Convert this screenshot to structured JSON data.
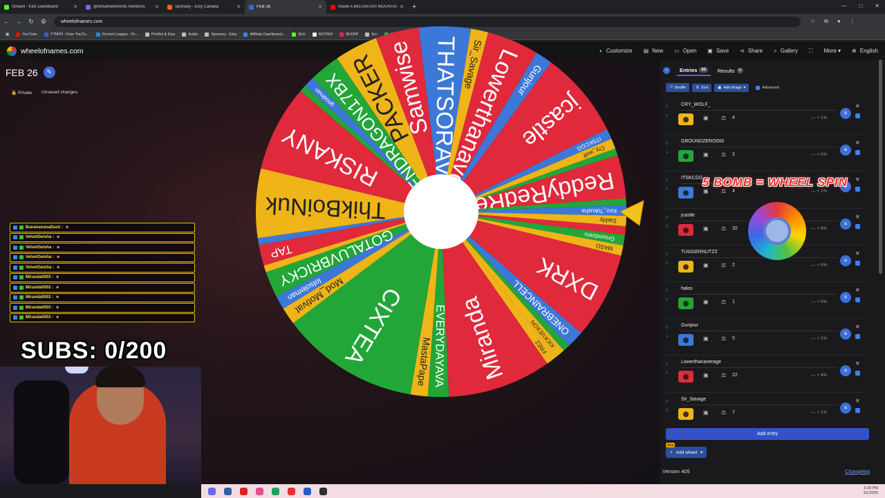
{
  "browser": {
    "tabs": [
      {
        "title": "Stream - Kick Dashboard",
        "color": "#53fc18",
        "active": false
      },
      {
        "title": "@streamelements mentions",
        "color": "#8b5cf6",
        "active": false
      },
      {
        "title": "Sponsey - Etsy Canada",
        "color": "#f1641e",
        "active": false
      },
      {
        "title": "FEB 26",
        "color": "#3369e8",
        "active": true
      },
      {
        "title": "Inside A $43,000,000 MOUNTAIN",
        "color": "#ff0000",
        "active": false
      }
    ],
    "url": "wheelofnames.com",
    "bookmarks": [
      {
        "label": "YouTube",
        "color": "#ff0000"
      },
      {
        "label": "YTMP3 - Free YouTu...",
        "color": "#3b5bdb"
      },
      {
        "label": "Rocket League - Dr...",
        "color": "#1e88e5"
      },
      {
        "label": "Printful & Etsy",
        "color": "#bbbbbb"
      },
      {
        "label": "Audio",
        "color": "#bbbbbb"
      },
      {
        "label": "Sponsey - Etsy",
        "color": "#bbbbbb"
      },
      {
        "label": "Affiliate Dashboard...",
        "color": "#3b82f6"
      },
      {
        "label": "Kick",
        "color": "#53fc18"
      },
      {
        "label": "BOTRIX",
        "color": "#eeeeee"
      },
      {
        "label": "BLERP",
        "color": "#e91e63"
      },
      {
        "label": "ttcc",
        "color": "#bbbbbb"
      },
      {
        "label": "SUH DRIVE",
        "color": "#34a853"
      }
    ]
  },
  "site": {
    "logo": "wheelofnames.com",
    "menu": [
      {
        "label": "Customize",
        "icon": "palette-icon",
        "glyph": "◐"
      },
      {
        "label": "New",
        "icon": "file-icon",
        "glyph": "▤"
      },
      {
        "label": "Open",
        "icon": "folder-icon",
        "glyph": "▭"
      },
      {
        "label": "Save",
        "icon": "save-icon",
        "glyph": "▣"
      },
      {
        "label": "Share",
        "icon": "share-icon",
        "glyph": "⋖"
      },
      {
        "label": "Gallery",
        "icon": "search-icon",
        "glyph": "⌕"
      },
      {
        "label": "",
        "icon": "fullscreen-icon",
        "glyph": "⛶"
      },
      {
        "label": "More ▾",
        "icon": "",
        "glyph": ""
      },
      {
        "label": "English",
        "icon": "globe-icon",
        "glyph": "⊕"
      }
    ]
  },
  "wheel": {
    "title": "FEB 26",
    "privacy": "Private",
    "status": "Unsaved changes",
    "colors": {
      "red": "#e0293b",
      "blue": "#3c78d8",
      "green": "#23a638",
      "yellow": "#eeb418"
    },
    "slices": [
      {
        "name": "THATSORAVEN",
        "color": "blue",
        "size": 3
      },
      {
        "name": "Sir_Savage",
        "color": "yellow",
        "size": 1
      },
      {
        "name": "Lowerthanaverage",
        "color": "red",
        "size": 3
      },
      {
        "name": "Gunjour",
        "color": "blue",
        "size": 1
      },
      {
        "name": "jcastle",
        "color": "red",
        "size": 5
      },
      {
        "name": "ITSKCGG",
        "color": "blue",
        "size": 0.6
      },
      {
        "name": "Cry_wolf",
        "color": "yellow",
        "size": 0.6
      },
      {
        "name": "",
        "color": "green",
        "size": 0.4
      },
      {
        "name": "ReddyRedRed",
        "color": "red",
        "size": 2.5
      },
      {
        "name": "",
        "color": "green",
        "size": 0.4
      },
      {
        "name": "Kiro_Tokusha",
        "color": "blue",
        "size": 0.6
      },
      {
        "name": "Daddy",
        "color": "yellow",
        "size": 0.6
      },
      {
        "name": "",
        "color": "red",
        "size": 0.5
      },
      {
        "name": "Groundzero",
        "color": "green",
        "size": 0.6
      },
      {
        "name": "MASO",
        "color": "yellow",
        "size": 0.6
      },
      {
        "name": "DXRK",
        "color": "red",
        "size": 5
      },
      {
        "name": "ONEBRAINCELL",
        "color": "blue",
        "size": 1
      },
      {
        "name": "",
        "color": "green",
        "size": 0.4
      },
      {
        "name": "KICKVEXON",
        "color": "yellow",
        "size": 0.6
      },
      {
        "name": "FREZ",
        "color": "yellow",
        "size": 0.6
      },
      {
        "name": "Miranda",
        "color": "red",
        "size": 6
      },
      {
        "name": "EVERYDAYAVA",
        "color": "green",
        "size": 1.2
      },
      {
        "name": "MastaPape",
        "color": "yellow",
        "size": 1
      },
      {
        "name": "CIXTEA",
        "color": "green",
        "size": 8
      },
      {
        "name": "Mod_Motivat",
        "color": "yellow",
        "size": 1
      },
      {
        "name": "lolsoleman",
        "color": "blue",
        "size": 0.8
      },
      {
        "name": "GOTALUVBRICKY",
        "color": "green",
        "size": 1.5
      },
      {
        "name": "",
        "color": "yellow",
        "size": 0.4
      },
      {
        "name": "TAP",
        "color": "red",
        "size": 1.2
      },
      {
        "name": "",
        "color": "blue",
        "size": 0.4
      },
      {
        "name": "ThikBoiNuk",
        "color": "yellow",
        "size": 4
      },
      {
        "name": "RISKANY",
        "color": "red",
        "size": 5
      },
      {
        "name": "",
        "color": "green",
        "size": 0.4
      },
      {
        "name": "goodman",
        "color": "blue",
        "size": 0.6
      },
      {
        "name": "FALLENDRAGON17BX",
        "color": "green",
        "size": 1.8
      },
      {
        "name": "PACKER",
        "color": "yellow",
        "size": 2.5
      },
      {
        "name": "Samwise",
        "color": "red",
        "size": 2.5
      }
    ]
  },
  "overlay": {
    "chat": [
      {
        "user": "BananananaDuck :",
        "color": "#f4e04d"
      },
      {
        "user": "VelvetGeisha :",
        "color": "#f4e04d"
      },
      {
        "user": "VelvetGeisha :",
        "color": "#f4e04d"
      },
      {
        "user": "VelvetGeisha :",
        "color": "#f4e04d"
      },
      {
        "user": "VelvetGeisha :",
        "color": "#f4e04d"
      },
      {
        "user": "Miranda0003 :",
        "color": "#f4e04d"
      },
      {
        "user": "Miranda0003 :",
        "color": "#f4e04d"
      },
      {
        "user": "Miranda0003 :",
        "color": "#f4e04d"
      },
      {
        "user": "Miranda0003 :",
        "color": "#f4e04d"
      },
      {
        "user": "Miranda0003 :",
        "color": "#f4e04d"
      }
    ],
    "subs": "SUBS: 0/200",
    "promo": "5 BOMB = WHEEL SPIN"
  },
  "panel": {
    "tabs": [
      {
        "label": "Entries",
        "count": "43"
      },
      {
        "label": "Results",
        "count": "0"
      }
    ],
    "tools": {
      "shuffle": "Shuffle",
      "sort": "Sort",
      "add_image": "Add image",
      "advanced": "Advanced"
    },
    "entries": [
      {
        "name": "CRY_WOLF_",
        "color": "#eeb418",
        "weight": "4",
        "pct": "1%"
      },
      {
        "name": "GROUNDZERO000",
        "color": "#23a638",
        "weight": "2",
        "pct": "0%"
      },
      {
        "name": "ITSKCGG",
        "color": "#3c78d8",
        "weight": "4",
        "pct": "1%"
      },
      {
        "name": "jcastle",
        "color": "#e0293b",
        "weight": "32",
        "pct": "6%"
      },
      {
        "name": "TUGGERNUTZZ",
        "color": "#eeb418",
        "weight": "2",
        "pct": "0%"
      },
      {
        "name": "halos",
        "color": "#23a638",
        "weight": "1",
        "pct": "0%"
      },
      {
        "name": "Gunjour",
        "color": "#3c78d8",
        "weight": "5",
        "pct": "1%"
      },
      {
        "name": "Lowerthanaverage",
        "color": "#e0293b",
        "weight": "22",
        "pct": "4%"
      },
      {
        "name": "Sir_Savage",
        "color": "#eeb418",
        "weight": "7",
        "pct": "1%"
      }
    ],
    "add_entry": "Add entry",
    "add_wheel": "Add wheel",
    "beta": "Beta",
    "version": "Version 405",
    "changelog": "Changelog"
  },
  "taskbar": {
    "time": "6:29 PM",
    "date": "3/1/2025",
    "apps": [
      "#6a6af0",
      "#3060a0",
      "#e02020",
      "#e05090",
      "#20a060",
      "#e03030",
      "#2060c0",
      "#303030"
    ]
  }
}
